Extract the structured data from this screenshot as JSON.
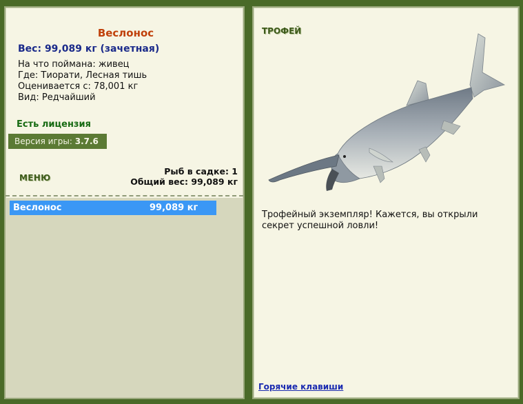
{
  "fish": {
    "name": "Веслонос",
    "weight_line": "Вес: 99,089 кг (зачетная)",
    "bait": "На что поймана: живец",
    "location": "Где: Тиорати, Лесная тишь",
    "valued_from": "Оценивается с: 78,001 кг",
    "kind": "Вид: Редчайший"
  },
  "license": "Есть лицензия",
  "version": {
    "label": "Версия игры:",
    "value": "3.7.6"
  },
  "menu_label": "МЕНЮ",
  "stats": {
    "fish_in_keepnet": "Рыб в садке: 1",
    "total_weight": "Общий вес: 99,089 кг"
  },
  "catch_list": [
    {
      "name": "Веслонос",
      "weight": "99,089 кг"
    }
  ],
  "trophy": {
    "label": "ТРОФЕЙ",
    "message": "Трофейный экземпляр! Кажется, вы открыли секрет успешной ловли!"
  },
  "hotkeys_link": "Горячие клавиши",
  "colors": {
    "frame": "#4a6a28",
    "panel": "#f6f5e4",
    "fish_title": "#c0410b",
    "weight": "#1a2a8a",
    "license": "#166a12",
    "selected_row": "#3a97f5",
    "link": "#1a2ab0"
  }
}
